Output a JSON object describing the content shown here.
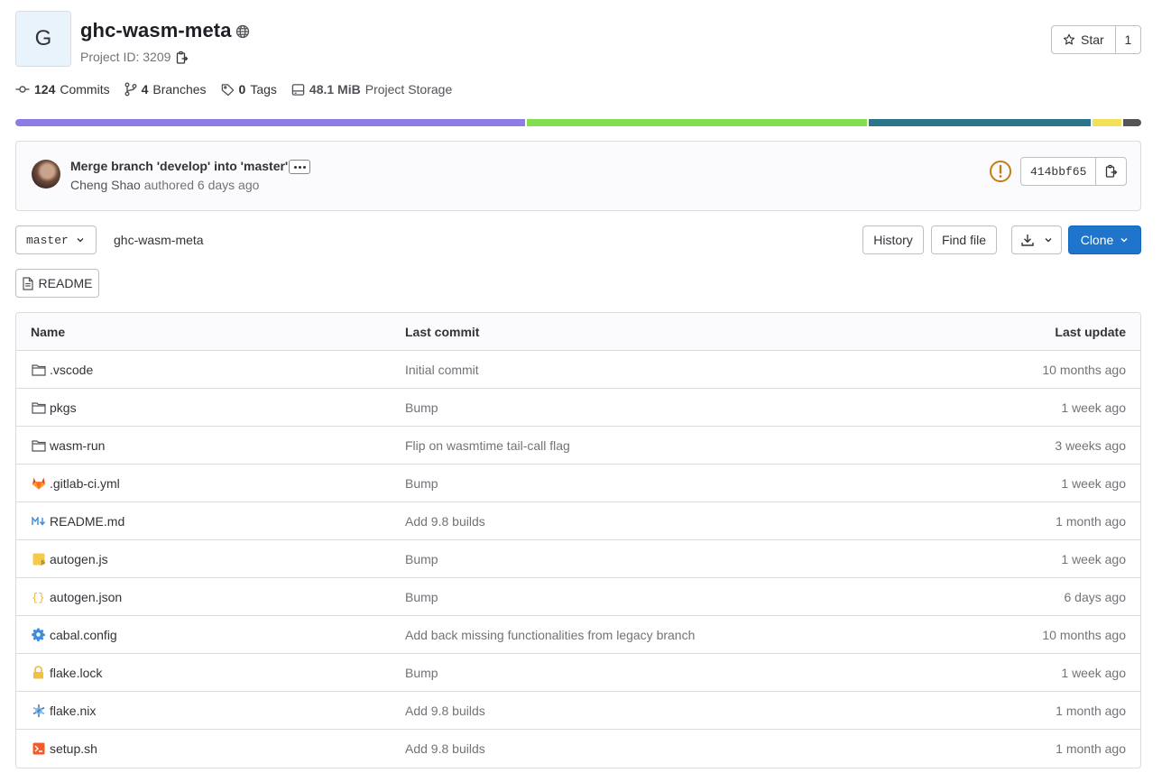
{
  "project": {
    "avatar_letter": "G",
    "name": "ghc-wasm-meta",
    "id_label": "Project ID: 3209"
  },
  "star": {
    "label": "Star",
    "count": "1"
  },
  "stats": {
    "commits_count": "124",
    "commits_label": "Commits",
    "branches_count": "4",
    "branches_label": "Branches",
    "tags_count": "0",
    "tags_label": "Tags",
    "storage_size": "48.1 MiB",
    "storage_label": "Project Storage"
  },
  "language_bar": [
    {
      "color": "#8e7ce6",
      "share": 45.4
    },
    {
      "color": "#82dd4f",
      "share": 30.3
    },
    {
      "color": "#2b7489",
      "share": 19.8
    },
    {
      "color": "#f1e05a",
      "share": 2.6
    },
    {
      "color": "#555555",
      "share": 1.6
    }
  ],
  "last_commit": {
    "message": "Merge branch 'develop' into 'master'",
    "author": "Cheng Shao",
    "authored_text": "authored 6 days ago",
    "sha": "414bbf65",
    "pipeline_status_color": "#c17d10"
  },
  "toolbar": {
    "branch": "master",
    "breadcrumb": "ghc-wasm-meta",
    "history_label": "History",
    "find_file_label": "Find file",
    "clone_label": "Clone",
    "readme_label": "README"
  },
  "table": {
    "headers": {
      "name": "Name",
      "last_commit": "Last commit",
      "last_update": "Last update"
    },
    "rows": [
      {
        "name": ".vscode",
        "icon": "folder-icon",
        "commit": "Initial commit",
        "updated": "10 months ago"
      },
      {
        "name": "pkgs",
        "icon": "folder-icon",
        "commit": "Bump",
        "updated": "1 week ago"
      },
      {
        "name": "wasm-run",
        "icon": "folder-icon",
        "commit": "Flip on wasmtime tail-call flag",
        "updated": "3 weeks ago"
      },
      {
        "name": ".gitlab-ci.yml",
        "icon": "gitlab-icon",
        "commit": "Bump",
        "updated": "1 week ago"
      },
      {
        "name": "README.md",
        "icon": "markdown-icon",
        "commit": "Add 9.8 builds",
        "updated": "1 month ago"
      },
      {
        "name": "autogen.js",
        "icon": "javascript-icon",
        "commit": "Bump",
        "updated": "1 week ago"
      },
      {
        "name": "autogen.json",
        "icon": "json-icon",
        "commit": "Bump",
        "updated": "6 days ago"
      },
      {
        "name": "cabal.config",
        "icon": "gear-icon",
        "commit": "Add back missing functionalities from legacy branch",
        "updated": "10 months ago"
      },
      {
        "name": "flake.lock",
        "icon": "lock-icon",
        "commit": "Bump",
        "updated": "1 week ago"
      },
      {
        "name": "flake.nix",
        "icon": "nix-icon",
        "commit": "Add 9.8 builds",
        "updated": "1 month ago"
      },
      {
        "name": "setup.sh",
        "icon": "terminal-icon",
        "commit": "Add 9.8 builds",
        "updated": "1 month ago"
      }
    ]
  }
}
